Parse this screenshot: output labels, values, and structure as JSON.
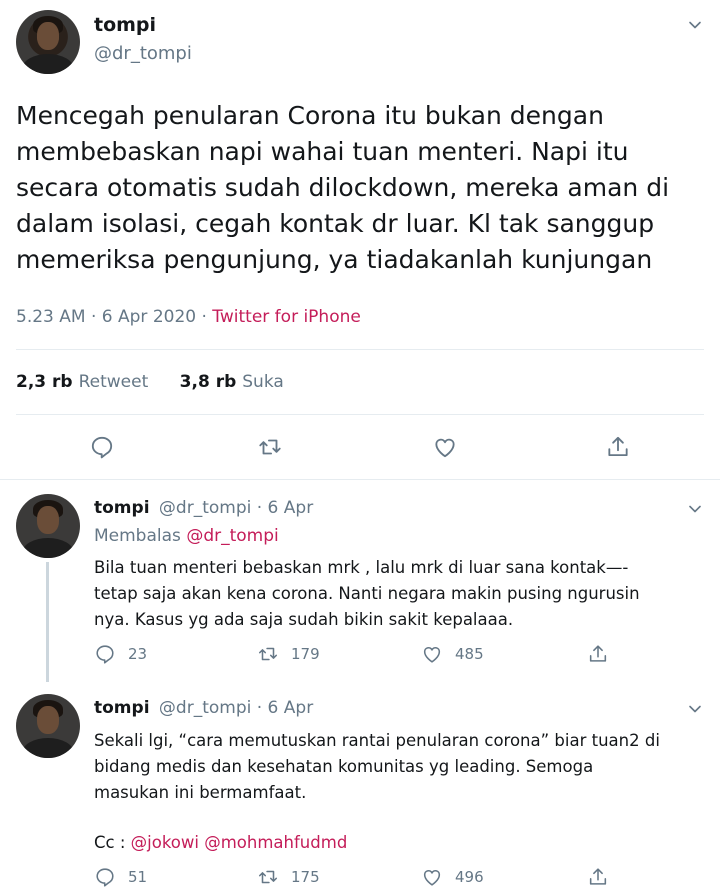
{
  "main_tweet": {
    "name": "tompi",
    "handle": "@dr_tompi",
    "text_lines": [
      "Mencegah penularan Corona itu bukan dengan",
      "membebaskan napi wahai tuan menteri. Napi itu",
      "secara otomatis sudah dilockdown, mereka aman di",
      "dalam isolasi, cegah kontak dr luar. Kl tak sanggup",
      "memeriksa pengunjung, ya tiadakanlah kunjungan"
    ],
    "time": "5.23 AM",
    "date": "6 Apr 2020",
    "separator": "·",
    "source": "Twitter for iPhone",
    "retweets_count": "2,3 rb",
    "retweets_label": "Retweet",
    "likes_count": "3,8 rb",
    "likes_label": "Suka"
  },
  "replies": [
    {
      "name": "tompi",
      "handle_date": "@dr_tompi · 6 Apr",
      "replying_label": "Membalas",
      "replying_to": "@dr_tompi",
      "text_lines": [
        "Bila tuan menteri bebaskan mrk , lalu mrk di luar sana kontak—-",
        "tetap saja akan kena corona. Nanti negara makin pusing ngurusin",
        "nya.  Kasus yg ada saja sudah bikin sakit kepalaaa."
      ],
      "reply_count": "23",
      "retweet_count": "179",
      "like_count": "485"
    },
    {
      "name": "tompi",
      "handle_date": "@dr_tompi · 6 Apr",
      "text_lines": [
        "Sekali lgi, “cara memutuskan rantai penularan corona”  biar tuan2 di",
        "bidang medis dan kesehatan komunitas yg leading. Semoga",
        "masukan ini bermamfaat."
      ],
      "cc_label": "Cc :",
      "cc_mention_1": "@jokowi",
      "cc_mention_2": "@mohmahfudmd",
      "reply_count": "51",
      "retweet_count": "175",
      "like_count": "496"
    }
  ],
  "icons": {
    "reply": "reply-icon",
    "retweet": "retweet-icon",
    "like": "heart-icon",
    "share": "share-icon",
    "more": "chevron-down-icon"
  },
  "colors": {
    "accent": "#c41d59",
    "secondary_text": "#657786",
    "primary_text": "#14171a",
    "divider": "#e6ecf0"
  }
}
